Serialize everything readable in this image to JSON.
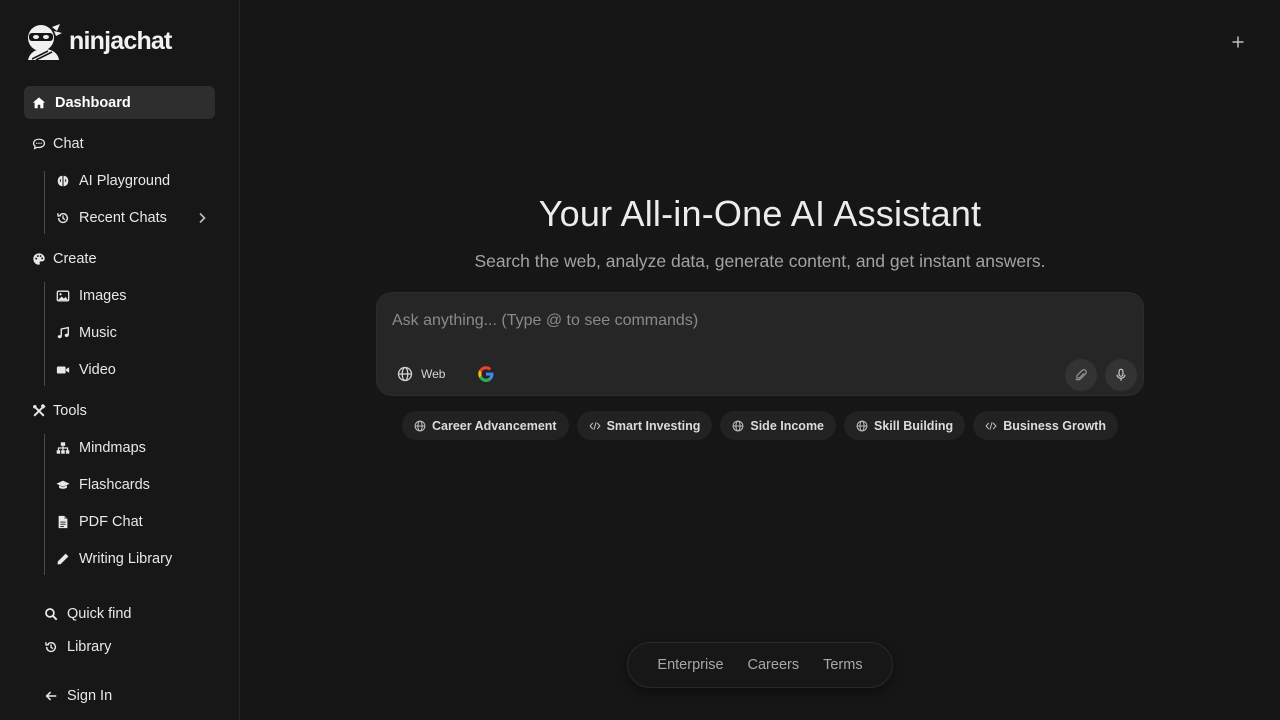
{
  "brand": {
    "name": "ninjachat"
  },
  "sidebar": {
    "dashboard": "Dashboard",
    "chat": {
      "label": "Chat",
      "items": [
        "AI Playground",
        "Recent Chats"
      ]
    },
    "create": {
      "label": "Create",
      "items": [
        "Images",
        "Music",
        "Video"
      ]
    },
    "tools": {
      "label": "Tools",
      "items": [
        "Mindmaps",
        "Flashcards",
        "PDF Chat",
        "Writing Library"
      ]
    },
    "bottom": {
      "quick_find": "Quick find",
      "library": "Library",
      "sign_in": "Sign In"
    }
  },
  "hero": {
    "title": "Your All-in-One AI Assistant",
    "subtitle": "Search the web, analyze data, generate content, and get instant answers."
  },
  "chat_box": {
    "placeholder": "Ask anything... (Type @ to see commands)",
    "web_label": "Web"
  },
  "chips": [
    {
      "label": "Career Advancement",
      "icon": "globe-icon"
    },
    {
      "label": "Smart Investing",
      "icon": "code-icon"
    },
    {
      "label": "Side Income",
      "icon": "globe-icon"
    },
    {
      "label": "Skill Building",
      "icon": "globe-icon"
    },
    {
      "label": "Business Growth",
      "icon": "code-icon"
    }
  ],
  "footer": {
    "links": [
      "Enterprise",
      "Careers",
      "Terms"
    ]
  },
  "colors": {
    "background": "#161616",
    "sidebar_active": "#2e2e2e",
    "input_bg": "#262626"
  }
}
